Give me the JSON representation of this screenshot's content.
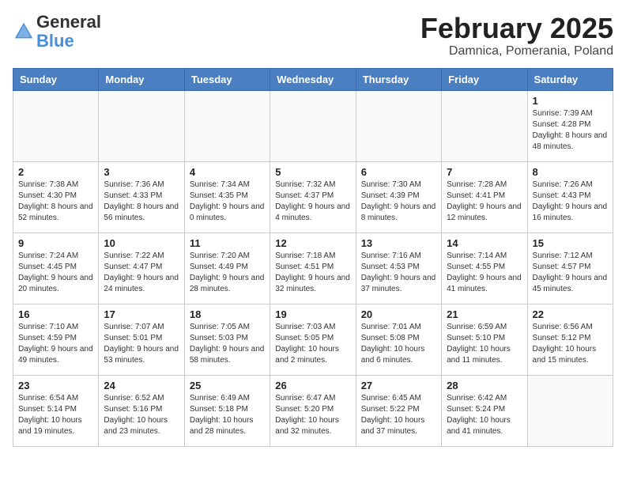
{
  "header": {
    "logo_general": "General",
    "logo_blue": "Blue",
    "month_title": "February 2025",
    "subtitle": "Damnica, Pomerania, Poland"
  },
  "weekdays": [
    "Sunday",
    "Monday",
    "Tuesday",
    "Wednesday",
    "Thursday",
    "Friday",
    "Saturday"
  ],
  "weeks": [
    [
      {
        "day": "",
        "info": ""
      },
      {
        "day": "",
        "info": ""
      },
      {
        "day": "",
        "info": ""
      },
      {
        "day": "",
        "info": ""
      },
      {
        "day": "",
        "info": ""
      },
      {
        "day": "",
        "info": ""
      },
      {
        "day": "1",
        "info": "Sunrise: 7:39 AM\nSunset: 4:28 PM\nDaylight: 8 hours and 48 minutes."
      }
    ],
    [
      {
        "day": "2",
        "info": "Sunrise: 7:38 AM\nSunset: 4:30 PM\nDaylight: 8 hours and 52 minutes."
      },
      {
        "day": "3",
        "info": "Sunrise: 7:36 AM\nSunset: 4:33 PM\nDaylight: 8 hours and 56 minutes."
      },
      {
        "day": "4",
        "info": "Sunrise: 7:34 AM\nSunset: 4:35 PM\nDaylight: 9 hours and 0 minutes."
      },
      {
        "day": "5",
        "info": "Sunrise: 7:32 AM\nSunset: 4:37 PM\nDaylight: 9 hours and 4 minutes."
      },
      {
        "day": "6",
        "info": "Sunrise: 7:30 AM\nSunset: 4:39 PM\nDaylight: 9 hours and 8 minutes."
      },
      {
        "day": "7",
        "info": "Sunrise: 7:28 AM\nSunset: 4:41 PM\nDaylight: 9 hours and 12 minutes."
      },
      {
        "day": "8",
        "info": "Sunrise: 7:26 AM\nSunset: 4:43 PM\nDaylight: 9 hours and 16 minutes."
      }
    ],
    [
      {
        "day": "9",
        "info": "Sunrise: 7:24 AM\nSunset: 4:45 PM\nDaylight: 9 hours and 20 minutes."
      },
      {
        "day": "10",
        "info": "Sunrise: 7:22 AM\nSunset: 4:47 PM\nDaylight: 9 hours and 24 minutes."
      },
      {
        "day": "11",
        "info": "Sunrise: 7:20 AM\nSunset: 4:49 PM\nDaylight: 9 hours and 28 minutes."
      },
      {
        "day": "12",
        "info": "Sunrise: 7:18 AM\nSunset: 4:51 PM\nDaylight: 9 hours and 32 minutes."
      },
      {
        "day": "13",
        "info": "Sunrise: 7:16 AM\nSunset: 4:53 PM\nDaylight: 9 hours and 37 minutes."
      },
      {
        "day": "14",
        "info": "Sunrise: 7:14 AM\nSunset: 4:55 PM\nDaylight: 9 hours and 41 minutes."
      },
      {
        "day": "15",
        "info": "Sunrise: 7:12 AM\nSunset: 4:57 PM\nDaylight: 9 hours and 45 minutes."
      }
    ],
    [
      {
        "day": "16",
        "info": "Sunrise: 7:10 AM\nSunset: 4:59 PM\nDaylight: 9 hours and 49 minutes."
      },
      {
        "day": "17",
        "info": "Sunrise: 7:07 AM\nSunset: 5:01 PM\nDaylight: 9 hours and 53 minutes."
      },
      {
        "day": "18",
        "info": "Sunrise: 7:05 AM\nSunset: 5:03 PM\nDaylight: 9 hours and 58 minutes."
      },
      {
        "day": "19",
        "info": "Sunrise: 7:03 AM\nSunset: 5:05 PM\nDaylight: 10 hours and 2 minutes."
      },
      {
        "day": "20",
        "info": "Sunrise: 7:01 AM\nSunset: 5:08 PM\nDaylight: 10 hours and 6 minutes."
      },
      {
        "day": "21",
        "info": "Sunrise: 6:59 AM\nSunset: 5:10 PM\nDaylight: 10 hours and 11 minutes."
      },
      {
        "day": "22",
        "info": "Sunrise: 6:56 AM\nSunset: 5:12 PM\nDaylight: 10 hours and 15 minutes."
      }
    ],
    [
      {
        "day": "23",
        "info": "Sunrise: 6:54 AM\nSunset: 5:14 PM\nDaylight: 10 hours and 19 minutes."
      },
      {
        "day": "24",
        "info": "Sunrise: 6:52 AM\nSunset: 5:16 PM\nDaylight: 10 hours and 23 minutes."
      },
      {
        "day": "25",
        "info": "Sunrise: 6:49 AM\nSunset: 5:18 PM\nDaylight: 10 hours and 28 minutes."
      },
      {
        "day": "26",
        "info": "Sunrise: 6:47 AM\nSunset: 5:20 PM\nDaylight: 10 hours and 32 minutes."
      },
      {
        "day": "27",
        "info": "Sunrise: 6:45 AM\nSunset: 5:22 PM\nDaylight: 10 hours and 37 minutes."
      },
      {
        "day": "28",
        "info": "Sunrise: 6:42 AM\nSunset: 5:24 PM\nDaylight: 10 hours and 41 minutes."
      },
      {
        "day": "",
        "info": ""
      }
    ]
  ]
}
